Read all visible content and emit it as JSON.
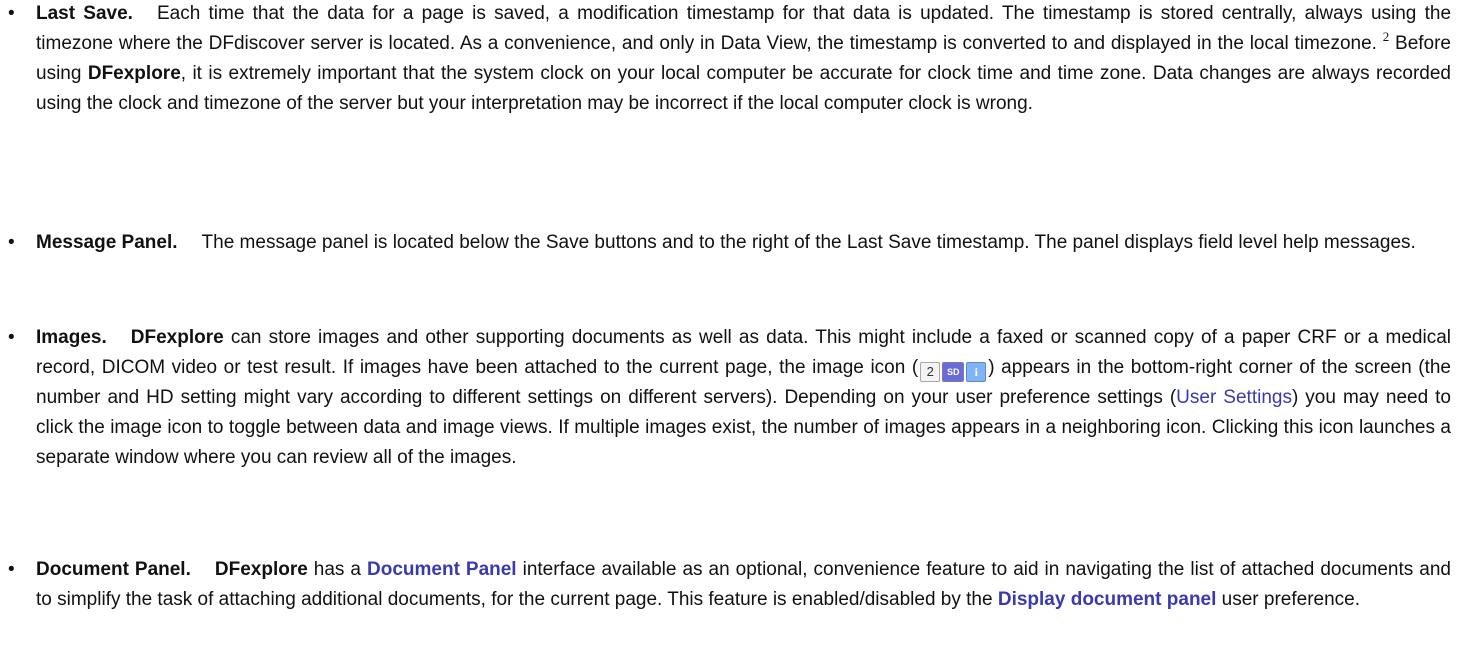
{
  "items": [
    {
      "term": "Last Save.",
      "text_1": "Each time that the data for a page is saved, a modification timestamp for that data is updated. The timestamp is stored centrally, always using the timezone where the DFdiscover server is located. As a convenience, and only in Data View, the timestamp is converted to and displayed in the local timezone.",
      "footnote": "2",
      "text_2": " Before using ",
      "bold_1": "DFexplore",
      "text_3": ", it is extremely important that the system clock on your local computer be accurate for clock time and time zone. Data changes are always recorded using the clock and timezone of the server but your interpretation may be incorrect if the local computer clock is wrong."
    },
    {
      "term": "Message Panel.",
      "text_1": "The message panel is located below the Save buttons and to the right of the Last Save timestamp. The panel displays field level help messages."
    },
    {
      "term": "Images.",
      "bold_1": "DFexplore",
      "text_1": " can store images and other supporting documents as well as data. This might include a faxed or scanned copy of a paper CRF or a medical record, DICOM video or test result. If images have been attached to the current page, the image icon (",
      "icon_number": "2",
      "icon_sd": "SD",
      "icon_info": "i",
      "text_2": ") appears in the bottom-right corner of the screen (the number and HD setting might vary according to different settings on different servers). Depending on your user preference settings (",
      "link_1": "User Settings",
      "text_3": ") you may need to click the image icon to toggle between data and image views. If multiple images exist, the number of images appears in a neighboring icon. Clicking this icon launches a separate window where you can review all of the images."
    },
    {
      "term": "Document Panel.",
      "bold_1": "DFexplore",
      "text_1": " has a ",
      "link_1": "Document Panel",
      "text_2": " interface available as an optional, convenience feature to aid in navigating the list of attached documents and to simplify the task of attaching additional documents, for the current page. This feature is enabled/disabled by the ",
      "link_2": "Display document panel",
      "text_3": " user preference."
    }
  ],
  "bullet": "•",
  "colors": {
    "text": "#111111",
    "link": "#3a3ab0",
    "icon_sd_bg": "#6a6ad8",
    "icon_info_bg": "#7fb5f5"
  }
}
